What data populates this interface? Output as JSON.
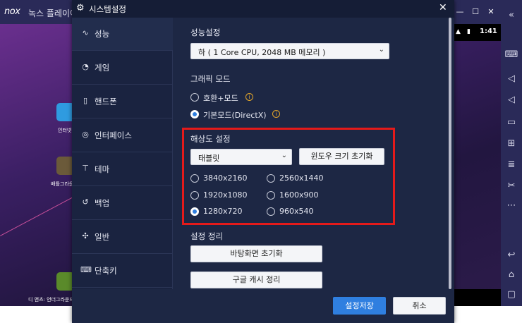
{
  "background_app": {
    "logo": "nox",
    "title": "녹스 플레이어",
    "status_time": "1:41",
    "apps": [
      {
        "label": "인터넷",
        "color": "#2f9be0"
      },
      {
        "label": "배틀그라운드",
        "color": "#6b5a3a"
      },
      {
        "label": "디 앤츠: 언더그라운드",
        "color": "#5a8a2a"
      }
    ],
    "right_toolbar_icons": [
      "collapse-icon",
      "keyboard-icon",
      "volume-up-icon",
      "volume-down-icon",
      "screen-icon",
      "add-apk-icon",
      "stack-icon",
      "scissors-icon",
      "more-icon",
      "back-icon",
      "home-icon",
      "recent-apps-icon"
    ]
  },
  "dialog": {
    "title": "시스템설정",
    "sidebar": [
      {
        "label": "성능",
        "icon": "pulse-icon",
        "active": true
      },
      {
        "label": "게임",
        "icon": "gamepad-icon",
        "active": false
      },
      {
        "label": "핸드폰",
        "icon": "phone-icon",
        "active": false
      },
      {
        "label": "인터페이스",
        "icon": "interface-icon",
        "active": false
      },
      {
        "label": "테마",
        "icon": "shirt-icon",
        "active": false
      },
      {
        "label": "백업",
        "icon": "backup-icon",
        "active": false
      },
      {
        "label": "일반",
        "icon": "puzzle-icon",
        "active": false
      },
      {
        "label": "단축키",
        "icon": "keyboard-icon",
        "active": false
      }
    ],
    "performance": {
      "title": "성능설정",
      "selected": "하 ( 1 Core CPU, 2048 MB 메모리 )"
    },
    "graphics": {
      "title": "그래픽 모드",
      "options": [
        {
          "label": "호환+모드",
          "checked": false
        },
        {
          "label": "기본모드(DirectX)",
          "checked": true
        }
      ]
    },
    "resolution": {
      "title": "해상도 설정",
      "device": "태블릿",
      "reset_window": "윈도우 크기 초기화",
      "options": [
        {
          "label": "3840x2160",
          "checked": false
        },
        {
          "label": "2560x1440",
          "checked": false
        },
        {
          "label": "1920x1080",
          "checked": false
        },
        {
          "label": "1600x900",
          "checked": false
        },
        {
          "label": "1280x720",
          "checked": true
        },
        {
          "label": "960x540",
          "checked": false
        }
      ]
    },
    "cleanup": {
      "title": "설정 정리",
      "reset_desktop": "바탕화면 초기화",
      "clear_google_cache": "구글 캐시 정리"
    },
    "footer": {
      "save": "설정저장",
      "cancel": "취소"
    },
    "highlight_color": "#e41a1a",
    "accent_color": "#2f7fe0"
  }
}
